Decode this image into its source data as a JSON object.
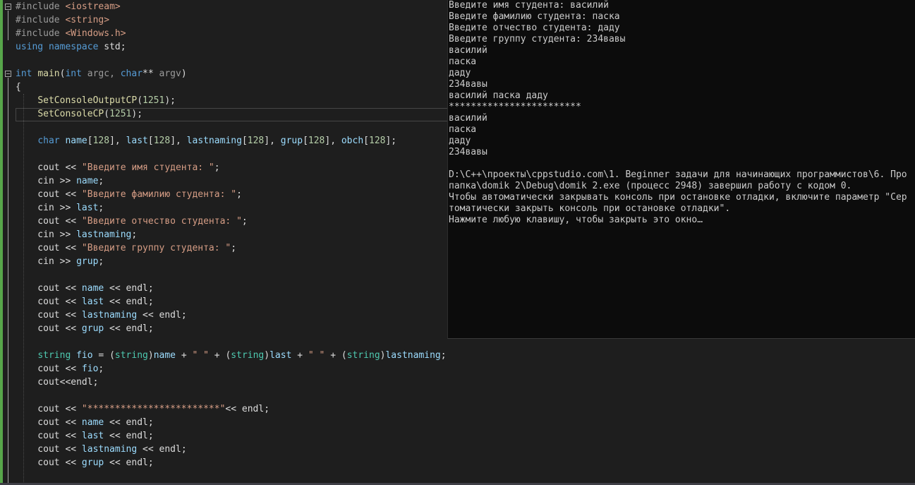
{
  "colors": {
    "background": "#1e1e1e",
    "keyword": "#569cd6",
    "string": "#d69d85",
    "function": "#dcdcaa",
    "variable": "#9cdcfe",
    "type": "#4ec9b0",
    "number": "#b5cea8",
    "preprocessor": "#9b9b9b",
    "plain": "#dcdcdc",
    "console_bg": "#0c0c0c",
    "console_text": "#cccccc"
  },
  "editor": {
    "lines": [
      [
        {
          "t": "#include ",
          "c": "preprocessor"
        },
        {
          "t": "<iostream>",
          "c": "string"
        }
      ],
      [
        {
          "t": "#include ",
          "c": "preprocessor"
        },
        {
          "t": "<string>",
          "c": "string"
        }
      ],
      [
        {
          "t": "#include ",
          "c": "preprocessor"
        },
        {
          "t": "<Windows.h>",
          "c": "string"
        }
      ],
      [
        {
          "t": "using ",
          "c": "keyword"
        },
        {
          "t": "namespace ",
          "c": "keyword"
        },
        {
          "t": "std;",
          "c": "plain"
        }
      ],
      [],
      [
        {
          "t": "int ",
          "c": "keyword"
        },
        {
          "t": "main",
          "c": "function"
        },
        {
          "t": "(",
          "c": "plain"
        },
        {
          "t": "int ",
          "c": "keyword"
        },
        {
          "t": "argc, ",
          "c": "preprocessor"
        },
        {
          "t": "char",
          "c": "keyword"
        },
        {
          "t": "** ",
          "c": "plain"
        },
        {
          "t": "argv",
          "c": "preprocessor"
        },
        {
          "t": ")",
          "c": "plain"
        }
      ],
      [
        {
          "t": "{",
          "c": "plain"
        }
      ],
      [
        {
          "t": "    ",
          "c": "plain"
        },
        {
          "t": "SetConsoleOutputCP",
          "c": "function"
        },
        {
          "t": "(",
          "c": "plain"
        },
        {
          "t": "1251",
          "c": "number"
        },
        {
          "t": ");",
          "c": "plain"
        }
      ],
      [
        {
          "t": "    ",
          "c": "plain"
        },
        {
          "t": "SetConsoleCP",
          "c": "function"
        },
        {
          "t": "(",
          "c": "plain"
        },
        {
          "t": "1251",
          "c": "number"
        },
        {
          "t": ");",
          "c": "plain"
        }
      ],
      [],
      [
        {
          "t": "    ",
          "c": "plain"
        },
        {
          "t": "char ",
          "c": "keyword"
        },
        {
          "t": "name",
          "c": "variable"
        },
        {
          "t": "[",
          "c": "plain"
        },
        {
          "t": "128",
          "c": "number"
        },
        {
          "t": "], ",
          "c": "plain"
        },
        {
          "t": "last",
          "c": "variable"
        },
        {
          "t": "[",
          "c": "plain"
        },
        {
          "t": "128",
          "c": "number"
        },
        {
          "t": "], ",
          "c": "plain"
        },
        {
          "t": "lastnaming",
          "c": "variable"
        },
        {
          "t": "[",
          "c": "plain"
        },
        {
          "t": "128",
          "c": "number"
        },
        {
          "t": "], ",
          "c": "plain"
        },
        {
          "t": "grup",
          "c": "variable"
        },
        {
          "t": "[",
          "c": "plain"
        },
        {
          "t": "128",
          "c": "number"
        },
        {
          "t": "], ",
          "c": "plain"
        },
        {
          "t": "obch",
          "c": "variable"
        },
        {
          "t": "[",
          "c": "plain"
        },
        {
          "t": "128",
          "c": "number"
        },
        {
          "t": "];",
          "c": "plain"
        }
      ],
      [],
      [
        {
          "t": "    cout << ",
          "c": "plain"
        },
        {
          "t": "\"Введите имя студента: \"",
          "c": "string"
        },
        {
          "t": ";",
          "c": "plain"
        }
      ],
      [
        {
          "t": "    cin >> ",
          "c": "plain"
        },
        {
          "t": "name",
          "c": "variable"
        },
        {
          "t": ";",
          "c": "plain"
        }
      ],
      [
        {
          "t": "    cout << ",
          "c": "plain"
        },
        {
          "t": "\"Введите фамилию студента: \"",
          "c": "string"
        },
        {
          "t": ";",
          "c": "plain"
        }
      ],
      [
        {
          "t": "    cin >> ",
          "c": "plain"
        },
        {
          "t": "last",
          "c": "variable"
        },
        {
          "t": ";",
          "c": "plain"
        }
      ],
      [
        {
          "t": "    cout << ",
          "c": "plain"
        },
        {
          "t": "\"Введите отчество студента: \"",
          "c": "string"
        },
        {
          "t": ";",
          "c": "plain"
        }
      ],
      [
        {
          "t": "    cin >> ",
          "c": "plain"
        },
        {
          "t": "lastnaming",
          "c": "variable"
        },
        {
          "t": ";",
          "c": "plain"
        }
      ],
      [
        {
          "t": "    cout << ",
          "c": "plain"
        },
        {
          "t": "\"Введите группу студента: \"",
          "c": "string"
        },
        {
          "t": ";",
          "c": "plain"
        }
      ],
      [
        {
          "t": "    cin >> ",
          "c": "plain"
        },
        {
          "t": "grup",
          "c": "variable"
        },
        {
          "t": ";",
          "c": "plain"
        }
      ],
      [],
      [
        {
          "t": "    cout << ",
          "c": "plain"
        },
        {
          "t": "name",
          "c": "variable"
        },
        {
          "t": " << endl;",
          "c": "plain"
        }
      ],
      [
        {
          "t": "    cout << ",
          "c": "plain"
        },
        {
          "t": "last",
          "c": "variable"
        },
        {
          "t": " << endl;",
          "c": "plain"
        }
      ],
      [
        {
          "t": "    cout << ",
          "c": "plain"
        },
        {
          "t": "lastnaming",
          "c": "variable"
        },
        {
          "t": " << endl;",
          "c": "plain"
        }
      ],
      [
        {
          "t": "    cout << ",
          "c": "plain"
        },
        {
          "t": "grup",
          "c": "variable"
        },
        {
          "t": " << endl;",
          "c": "plain"
        }
      ],
      [],
      [
        {
          "t": "    ",
          "c": "plain"
        },
        {
          "t": "string ",
          "c": "type"
        },
        {
          "t": "fio",
          "c": "variable"
        },
        {
          "t": " = (",
          "c": "plain"
        },
        {
          "t": "string",
          "c": "type"
        },
        {
          "t": ")",
          "c": "plain"
        },
        {
          "t": "name",
          "c": "variable"
        },
        {
          "t": " + ",
          "c": "plain"
        },
        {
          "t": "\" \"",
          "c": "string"
        },
        {
          "t": " + (",
          "c": "plain"
        },
        {
          "t": "string",
          "c": "type"
        },
        {
          "t": ")",
          "c": "plain"
        },
        {
          "t": "last",
          "c": "variable"
        },
        {
          "t": " + ",
          "c": "plain"
        },
        {
          "t": "\" \"",
          "c": "string"
        },
        {
          "t": " + (",
          "c": "plain"
        },
        {
          "t": "string",
          "c": "type"
        },
        {
          "t": ")",
          "c": "plain"
        },
        {
          "t": "lastnaming",
          "c": "variable"
        },
        {
          "t": ";",
          "c": "plain"
        }
      ],
      [
        {
          "t": "    cout << ",
          "c": "plain"
        },
        {
          "t": "fio",
          "c": "variable"
        },
        {
          "t": ";",
          "c": "plain"
        }
      ],
      [
        {
          "t": "    cout<<endl;",
          "c": "plain"
        }
      ],
      [],
      [
        {
          "t": "    cout << ",
          "c": "plain"
        },
        {
          "t": "\"************************\"",
          "c": "string"
        },
        {
          "t": "<< endl;",
          "c": "plain"
        }
      ],
      [
        {
          "t": "    cout << ",
          "c": "plain"
        },
        {
          "t": "name",
          "c": "variable"
        },
        {
          "t": " << endl;",
          "c": "plain"
        }
      ],
      [
        {
          "t": "    cout << ",
          "c": "plain"
        },
        {
          "t": "last",
          "c": "variable"
        },
        {
          "t": " << endl;",
          "c": "plain"
        }
      ],
      [
        {
          "t": "    cout << ",
          "c": "plain"
        },
        {
          "t": "lastnaming",
          "c": "variable"
        },
        {
          "t": " << endl;",
          "c": "plain"
        }
      ],
      [
        {
          "t": "    cout << ",
          "c": "plain"
        },
        {
          "t": "grup",
          "c": "variable"
        },
        {
          "t": " << endl;",
          "c": "plain"
        }
      ]
    ]
  },
  "console": {
    "lines": [
      "Введите имя студента: василий",
      "Введите фамилию студента: паска",
      "Введите отчество студента: даду",
      "Введите группу студента: 234вавы",
      "василий",
      "паска",
      "даду",
      "234вавы",
      "василий паска даду",
      "************************",
      "василий",
      "паска",
      "даду",
      "234вавы",
      "",
      "D:\\C++\\проекты\\cppstudio.com\\1. Beginner задачи для начинающих программистов\\6. Про",
      "папка\\domik 2\\Debug\\domik 2.exe (процесс 2948) завершил работу с кодом 0.",
      "Чтобы автоматически закрывать консоль при остановке отладки, включите параметр \"Сер",
      "томатически закрыть консоль при остановке отладки\".",
      "Нажмите любую клавишу, чтобы закрыть это окно…"
    ]
  }
}
